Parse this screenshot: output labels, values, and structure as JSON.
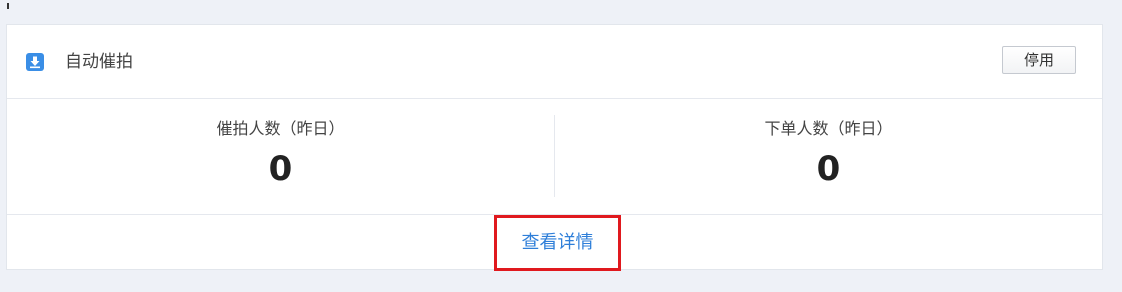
{
  "card": {
    "title": "自动催拍",
    "disable_label": "停用",
    "accent_color": "#3a8ee6",
    "icon": "download-box-icon"
  },
  "stats": [
    {
      "label": "催拍人数（昨日）",
      "value": "0"
    },
    {
      "label": "下单人数（昨日）",
      "value": "0"
    }
  ],
  "footer": {
    "details_label": "查看详情",
    "link_color": "#2f7fd9",
    "highlight_color": "#e0191e"
  }
}
